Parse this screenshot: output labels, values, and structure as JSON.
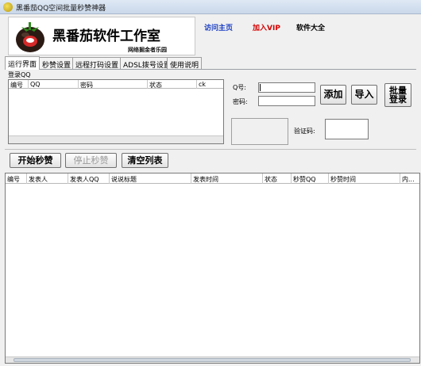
{
  "window": {
    "title": "黑番茄QQ空间批量秒赞神器"
  },
  "banner": {
    "logo_title": "黑番茄软件工作室",
    "logo_subtitle": "网络掘金者乐园",
    "links": {
      "home": "访问主页",
      "vip": "加入VIP",
      "software": "软件大全"
    }
  },
  "tabs": [
    {
      "label": "运行界面",
      "active": true
    },
    {
      "label": "秒赞设置",
      "active": false
    },
    {
      "label": "远程打码设置",
      "active": false
    },
    {
      "label": "ADSL拨号设置",
      "active": false
    },
    {
      "label": "使用说明",
      "active": false
    }
  ],
  "login": {
    "group_label": "登录QQ",
    "columns": [
      "编号",
      "QQ",
      "密码",
      "状态",
      "ck"
    ],
    "qq_label": "Q号:",
    "password_label": "密码:",
    "qq_value": "",
    "password_value": "",
    "captcha_label": "验证码:",
    "captcha_value": "",
    "add_button": "添加",
    "import_button": "导入",
    "batch_login_button": "批量登录"
  },
  "actions": {
    "start": "开始秒赞",
    "stop": "停止秒赞",
    "clear": "清空列表"
  },
  "results": {
    "columns": [
      "编号",
      "发表人",
      "发表人QQ",
      "说说标题",
      "发表时间",
      "状态",
      "秒赞QQ",
      "秒赞时间",
      "内..."
    ]
  },
  "colors": {
    "link_home": "#1a3ec2",
    "link_vip": "#d20000",
    "titlebar": "#c9d8ea"
  }
}
